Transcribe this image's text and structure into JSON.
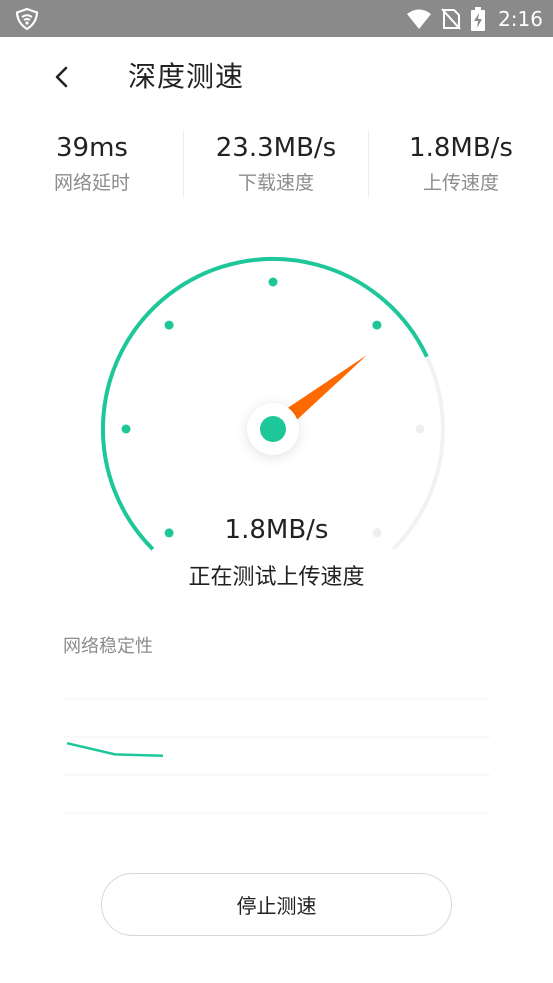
{
  "status_bar": {
    "time": "2:16",
    "icons": [
      "shield-icon",
      "wifi-icon",
      "no-sim-icon",
      "battery-charging-icon"
    ]
  },
  "header": {
    "back_icon": "chevron-left-icon",
    "title": "深度测速"
  },
  "stats": [
    {
      "value": "39ms",
      "label": "网络延时"
    },
    {
      "value": "23.3MB/s",
      "label": "下载速度"
    },
    {
      "value": "1.8MB/s",
      "label": "上传速度"
    }
  ],
  "gauge": {
    "value": "1.8MB/s",
    "status": "正在测试上传速度",
    "progress_fraction": 0.74,
    "accent_color": "#1dc79a",
    "needle_color": "#ff6a00"
  },
  "stability": {
    "title": "网络稳定性",
    "line_color": "#1dc79a",
    "series": [
      0.62,
      0.54,
      0.53
    ]
  },
  "actions": {
    "stop_label": "停止测速"
  }
}
